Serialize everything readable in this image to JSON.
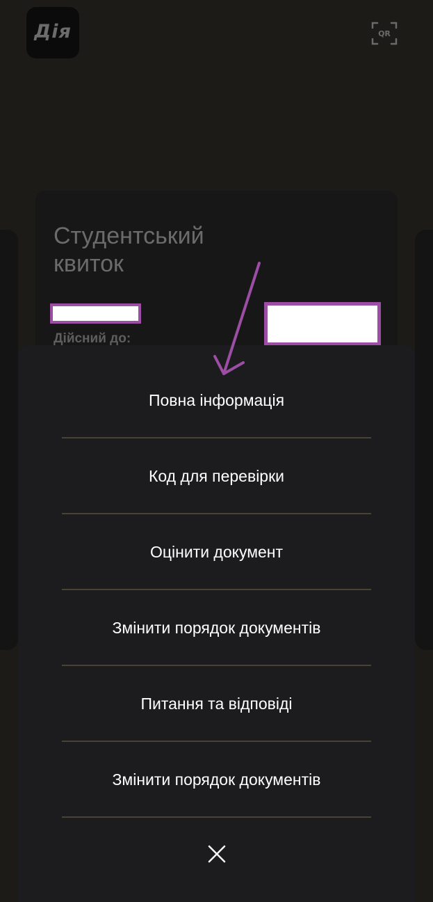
{
  "app": {
    "logo_text": "Дія",
    "qr_label": "QR"
  },
  "document": {
    "title": "Студентський квиток",
    "valid_until_label": "Дійсний до:"
  },
  "menu": {
    "items": [
      {
        "label": "Повна інформація"
      },
      {
        "label": "Код для перевірки"
      },
      {
        "label": "Оцінити документ"
      },
      {
        "label": "Змінити порядок документів"
      },
      {
        "label": "Питання та відповіді"
      },
      {
        "label": "Змінити порядок документів"
      }
    ],
    "close_icon": "close-icon"
  },
  "colors": {
    "background": "#1d1b17",
    "sheet": "#1c1c1e",
    "divider": "#4a4235",
    "annotation": "#9b4ea3"
  }
}
